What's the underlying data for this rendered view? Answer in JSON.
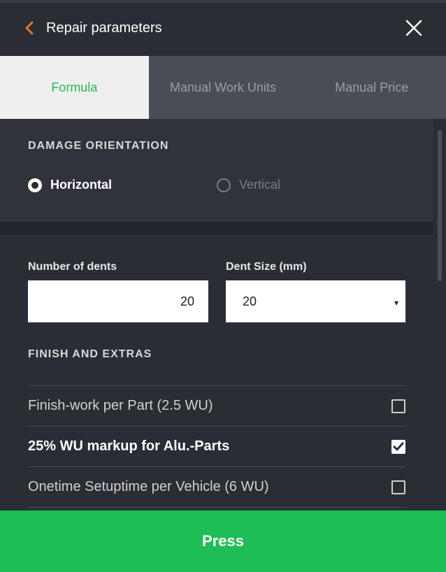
{
  "header": {
    "title": "Repair parameters",
    "accent_color": "#e87722"
  },
  "tabs": [
    {
      "label": "Formula",
      "active": true
    },
    {
      "label": "Manual Work Units",
      "active": false
    },
    {
      "label": "Manual Price",
      "active": false
    }
  ],
  "orientation": {
    "title": "DAMAGE ORIENTATION",
    "options": [
      {
        "label": "Horizontal",
        "checked": true
      },
      {
        "label": "Vertical",
        "checked": false
      }
    ]
  },
  "fields": {
    "dents_label": "Number of dents",
    "dents_value": "20",
    "size_label": "Dent Size (mm)",
    "size_value": "20"
  },
  "extras": {
    "title": "FINISH AND EXTRAS",
    "items": [
      {
        "label": "Finish-work per Part (2.5 WU)",
        "checked": false
      },
      {
        "label": "25% WU markup for Alu.-Parts",
        "checked": true
      },
      {
        "label": "Onetime Setuptime per Vehicle (6 WU)",
        "checked": false
      }
    ]
  },
  "footer": {
    "button_label": "Press",
    "button_color": "#1fbd56"
  }
}
